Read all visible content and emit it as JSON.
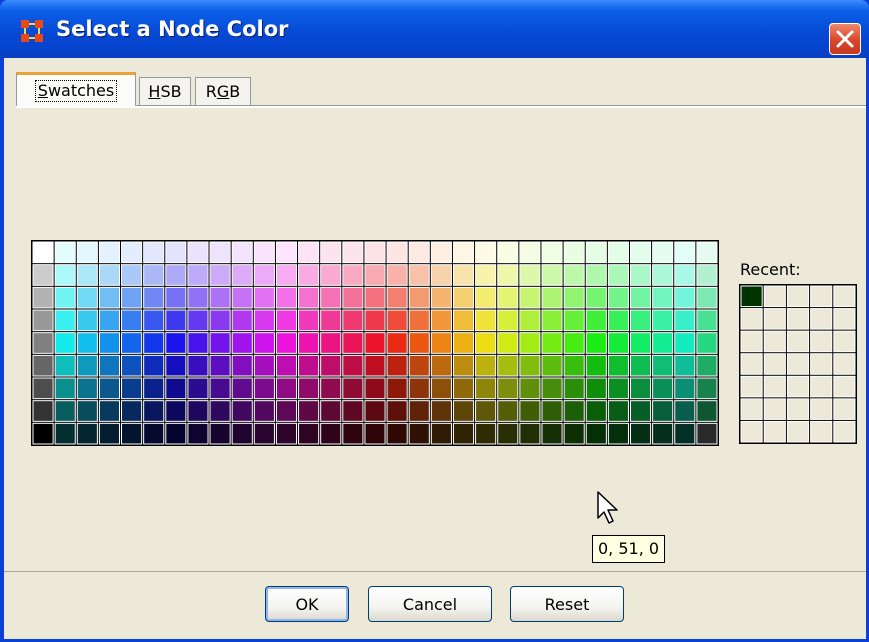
{
  "window": {
    "title": "Select a Node Color",
    "app_icon": "orange-nodes-icon",
    "close_icon": "close-icon"
  },
  "tabs": [
    {
      "label": "Swatches",
      "mnemonic": "S",
      "active": true
    },
    {
      "label": "HSB",
      "mnemonic": "H",
      "active": false
    },
    {
      "label": "RGB",
      "mnemonic": "G",
      "active": false
    }
  ],
  "swatches": {
    "grid_columns": 31,
    "grid_rows": 9
  },
  "recent": {
    "label": "Recent:",
    "grid_columns": 5,
    "grid_rows": 7,
    "colors": [
      "#003300"
    ]
  },
  "tooltip": {
    "text": "0, 51, 0"
  },
  "buttons": {
    "ok": "OK",
    "cancel": "Cancel",
    "reset": "Reset"
  },
  "colors": {
    "titlebar": "#0648d3",
    "client_background": "#ece9d8",
    "close_button": "#d9452a",
    "tab_highlight": "#e7a337"
  }
}
